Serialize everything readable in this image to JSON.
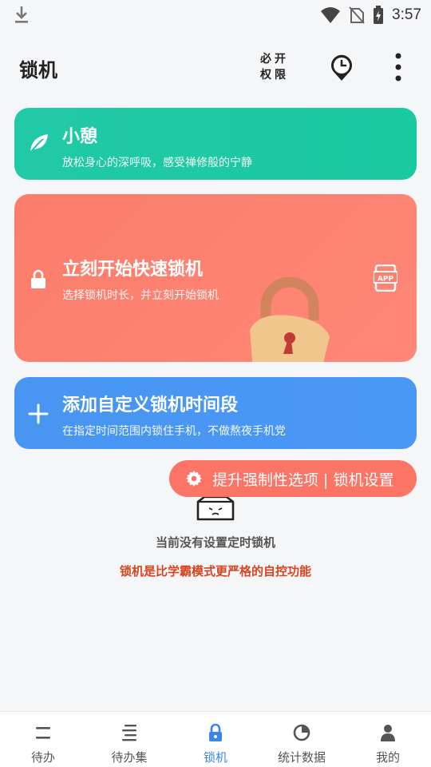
{
  "status_bar": {
    "time": "3:57"
  },
  "app_bar": {
    "title": "锁机",
    "permission_line1": "必开",
    "permission_line2": "权限"
  },
  "cards": {
    "rest": {
      "title": "小憩",
      "subtitle": "放松身心的深呼吸，感受禅修般的宁静",
      "icon": "leaf-icon"
    },
    "quick_lock": {
      "title": "立刻开始快速锁机",
      "subtitle": "选择锁机时长，并立刻开始锁机",
      "icon": "lock-icon",
      "app_label": "APP"
    },
    "custom": {
      "title": "添加自定义锁机时间段",
      "subtitle": "在指定时间范围内锁住手机，不做熬夜手机党",
      "icon": "plus-icon"
    }
  },
  "settings_pill": {
    "label": "提升强制性选项 | 锁机设置"
  },
  "empty_state": {
    "message": "当前没有设置定时锁机",
    "hint": "锁机是比学霸模式更严格的自控功能"
  },
  "bottom_nav": {
    "items": [
      {
        "label": "待办",
        "icon": "todo-icon"
      },
      {
        "label": "待办集",
        "icon": "todo-list-icon"
      },
      {
        "label": "锁机",
        "icon": "lock-icon",
        "active": true
      },
      {
        "label": "统计数据",
        "icon": "pie-chart-icon"
      },
      {
        "label": "我的",
        "icon": "person-icon"
      }
    ]
  },
  "colors": {
    "green": "#1fc9a3",
    "red": "#fd7f6e",
    "blue": "#4896f3",
    "active_nav": "#3a86e8",
    "hint": "#d9441f"
  }
}
